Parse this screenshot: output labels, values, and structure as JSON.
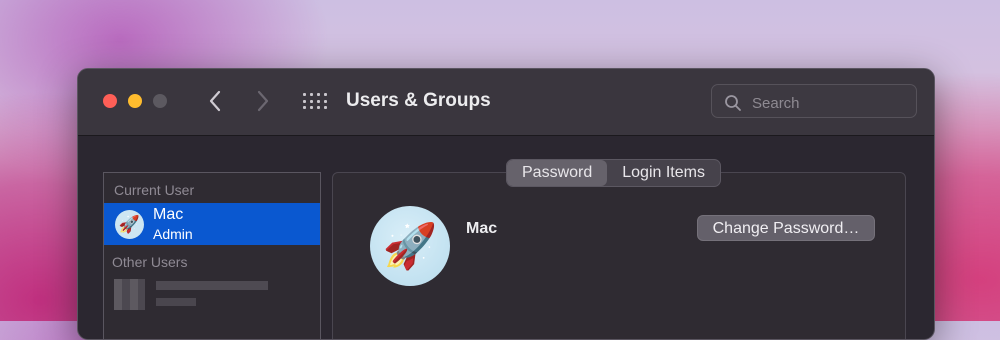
{
  "window": {
    "title": "Users & Groups"
  },
  "toolbar": {
    "back_icon": "chevron-left-icon",
    "forward_icon": "chevron-right-icon",
    "grid_icon": "show-all-grid-icon"
  },
  "search": {
    "placeholder": "Search",
    "value": ""
  },
  "sidebar": {
    "current_user_label": "Current User",
    "current_user": {
      "name": "Mac",
      "role": "Admin",
      "avatar": "🚀"
    },
    "other_users_label": "Other Users"
  },
  "tabs": [
    {
      "label": "Password",
      "active": true
    },
    {
      "label": "Login Items",
      "active": false
    }
  ],
  "main": {
    "name": "Mac",
    "avatar": "🚀",
    "change_password_label": "Change Password…"
  },
  "colors": {
    "close": "#fe5f57",
    "minimize": "#febc2e",
    "selection": "#0a58d0"
  }
}
